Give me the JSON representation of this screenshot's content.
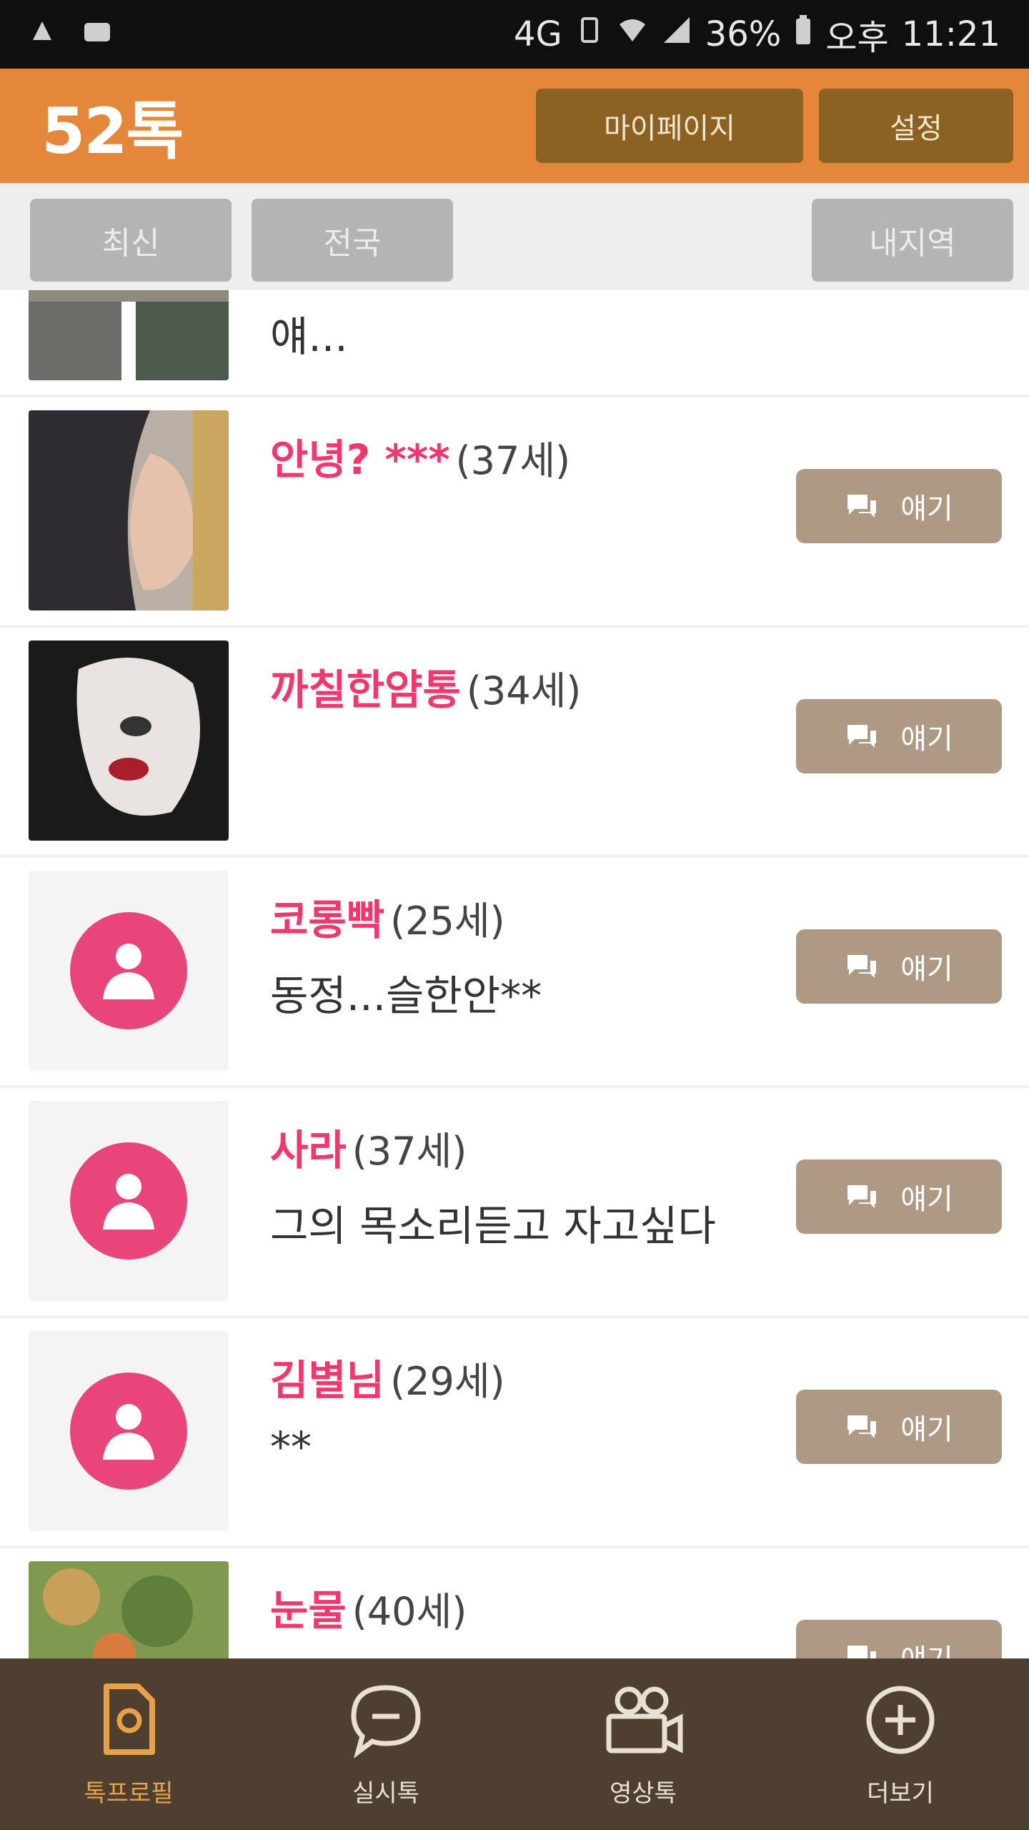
{
  "status_bar": {
    "network": "4G",
    "battery": "36%",
    "time_prefix": "오후",
    "time": "11:21"
  },
  "app": {
    "title": "52톡",
    "mypage_label": "마이페이지",
    "settings_label": "설정"
  },
  "filters": {
    "latest": "최신",
    "region": "전국",
    "nearby": "내지역"
  },
  "list": {
    "talk_label": "얘기",
    "items": [
      {
        "nick": "",
        "age": "",
        "message": "얘..."
      },
      {
        "nick": "안녕? ***",
        "age": "(37세)",
        "message": ""
      },
      {
        "nick": "까칠한얌통",
        "age": "(34세)",
        "message": ""
      },
      {
        "nick": "코롱빡",
        "age": "(25세)",
        "message": "동정...슬한안**"
      },
      {
        "nick": "사라",
        "age": "(37세)",
        "message": "그의 목소리듣고 자고싶다"
      },
      {
        "nick": "김별님",
        "age": "(29세)",
        "message": "**"
      },
      {
        "nick": "눈물",
        "age": "(40세)",
        "message": ""
      }
    ]
  },
  "nav": [
    {
      "label": "톡프로필",
      "icon": "profile-card-icon"
    },
    {
      "label": "실시톡",
      "icon": "chat-bubble-icon"
    },
    {
      "label": "영상톡",
      "icon": "video-camera-icon"
    },
    {
      "label": "더보기",
      "icon": "plus-circle-icon"
    }
  ],
  "colors": {
    "appbar": "#e5873b",
    "appbar_button": "#8c6223",
    "accent_pink": "#f0386f",
    "talk_button": "#ae9a84",
    "bottom_nav": "#4f3f30",
    "active_nav": "#e5a24a"
  }
}
